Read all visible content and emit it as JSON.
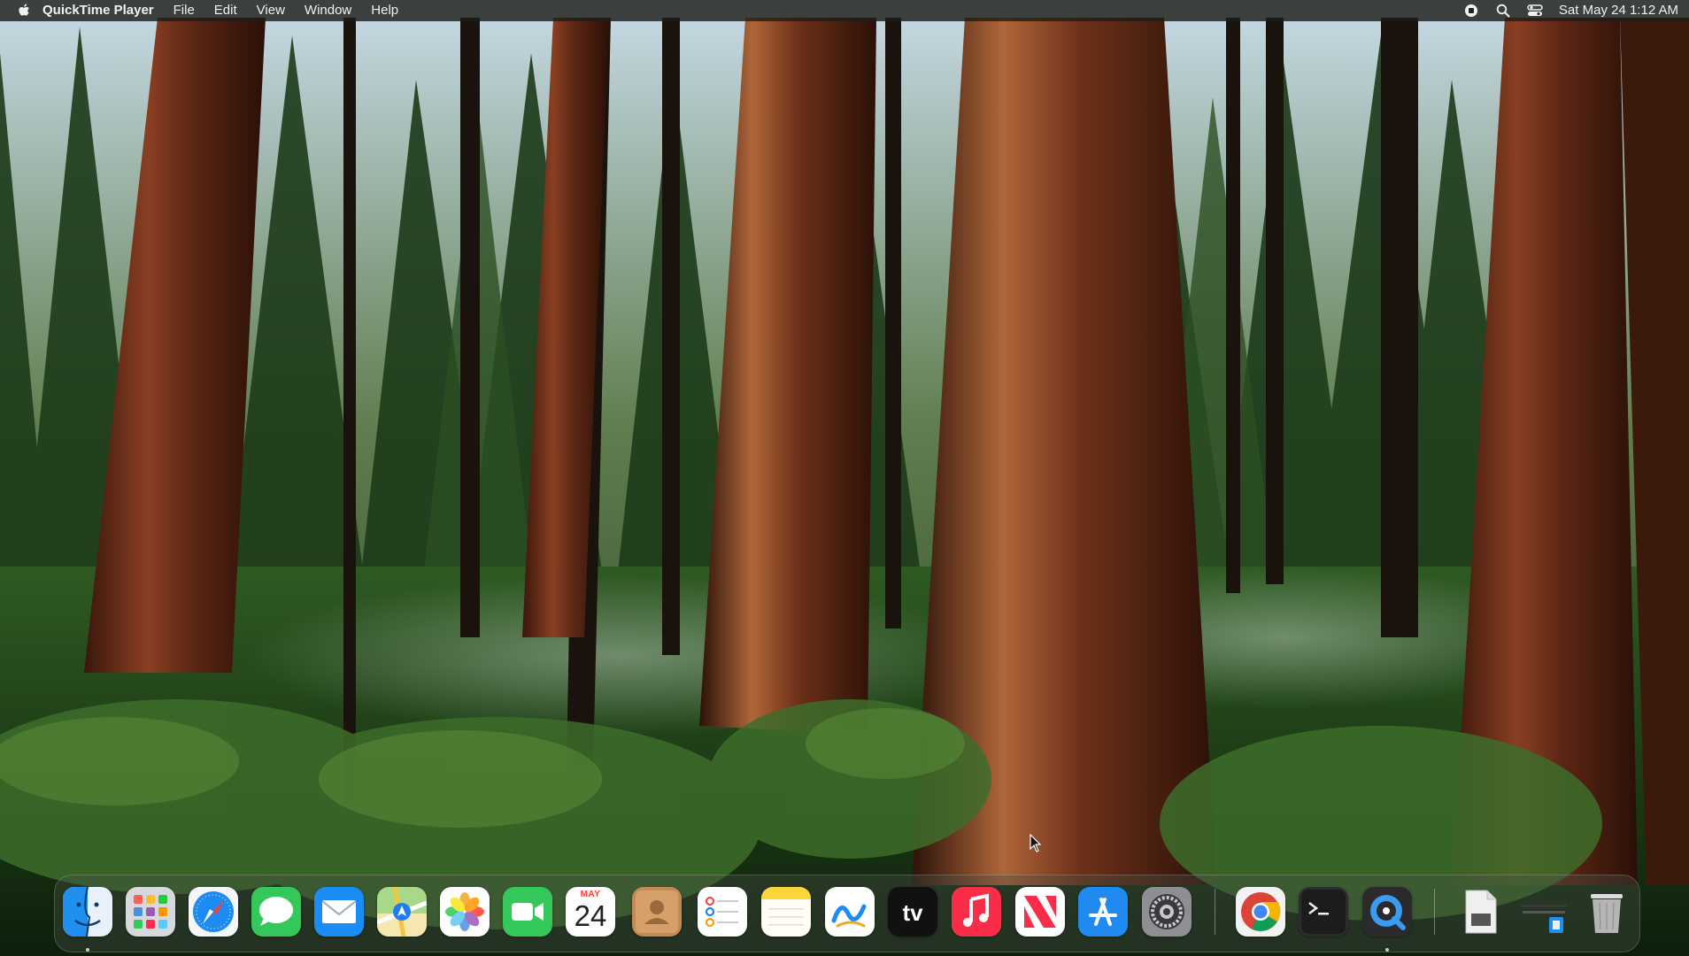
{
  "menubar": {
    "app_name": "QuickTime Player",
    "menus": [
      "File",
      "Edit",
      "View",
      "Window",
      "Help"
    ],
    "status_icons": [
      "screen-record-icon",
      "spotlight-search-icon",
      "control-center-icon"
    ],
    "clock": "Sat May 24  1:12 AM"
  },
  "dock": {
    "apps": [
      {
        "name": "Finder",
        "icon": "finder-icon",
        "running": true
      },
      {
        "name": "Launchpad",
        "icon": "launchpad-icon",
        "running": false
      },
      {
        "name": "Safari",
        "icon": "safari-icon",
        "running": false
      },
      {
        "name": "Messages",
        "icon": "messages-icon",
        "running": false
      },
      {
        "name": "Mail",
        "icon": "mail-icon",
        "running": false
      },
      {
        "name": "Maps",
        "icon": "maps-icon",
        "running": false
      },
      {
        "name": "Photos",
        "icon": "photos-icon",
        "running": false
      },
      {
        "name": "FaceTime",
        "icon": "facetime-icon",
        "running": false
      },
      {
        "name": "Calendar",
        "icon": "calendar-icon",
        "running": false,
        "month": "MAY",
        "day": "24"
      },
      {
        "name": "Contacts",
        "icon": "contacts-icon",
        "running": false
      },
      {
        "name": "Reminders",
        "icon": "reminders-icon",
        "running": false
      },
      {
        "name": "Notes",
        "icon": "notes-icon",
        "running": false
      },
      {
        "name": "Freeform",
        "icon": "freeform-icon",
        "running": false
      },
      {
        "name": "TV",
        "icon": "apple-tv-icon",
        "running": false,
        "label": "tv"
      },
      {
        "name": "Music",
        "icon": "music-icon",
        "running": false
      },
      {
        "name": "News",
        "icon": "news-icon",
        "running": false
      },
      {
        "name": "App Store",
        "icon": "app-store-icon",
        "running": false
      },
      {
        "name": "System Settings",
        "icon": "system-settings-icon",
        "running": false
      },
      {
        "name": "Google Chrome",
        "icon": "chrome-icon",
        "running": false
      },
      {
        "name": "Terminal",
        "icon": "terminal-icon",
        "running": false
      },
      {
        "name": "QuickTime Player",
        "icon": "quicktime-icon",
        "running": true
      },
      {
        "name": "Document",
        "icon": "document-icon",
        "running": false
      },
      {
        "name": "Downloads",
        "icon": "downloads-stack-icon",
        "running": false
      },
      {
        "name": "Trash",
        "icon": "trash-icon",
        "running": false
      }
    ]
  }
}
